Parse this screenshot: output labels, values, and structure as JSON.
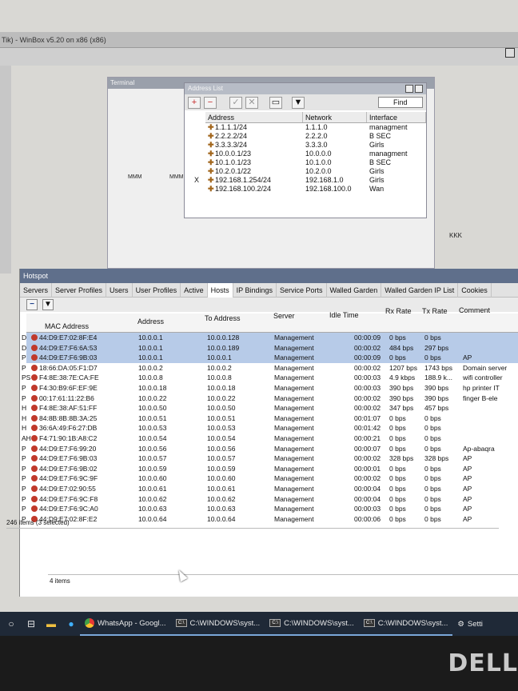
{
  "app": {
    "window_title": "Tik) - WinBox v5.20 on x86 (x86)"
  },
  "terminal": {
    "title": "Terminal",
    "labels": [
      "MMM",
      "MMM",
      "KKK"
    ]
  },
  "address_list": {
    "title": "Address List",
    "find_label": "Find",
    "columns": [
      "Address",
      "Network",
      "Interface"
    ],
    "rows": [
      {
        "flag": "",
        "address": "1.1.1.1/24",
        "network": "1.1.1.0",
        "interface": "managment"
      },
      {
        "flag": "",
        "address": "2.2.2.2/24",
        "network": "2.2.2.0",
        "interface": "B SEC"
      },
      {
        "flag": "",
        "address": "3.3.3.3/24",
        "network": "3.3.3.0",
        "interface": "Girls"
      },
      {
        "flag": "",
        "address": "10.0.0.1/23",
        "network": "10.0.0.0",
        "interface": "managment"
      },
      {
        "flag": "",
        "address": "10.1.0.1/23",
        "network": "10.1.0.0",
        "interface": "B SEC"
      },
      {
        "flag": "",
        "address": "10.2.0.1/22",
        "network": "10.2.0.0",
        "interface": "Girls"
      },
      {
        "flag": "X",
        "address": "192.168.1.254/24",
        "network": "192.168.1.0",
        "interface": "Girls"
      },
      {
        "flag": "",
        "address": "192.168.100.2/24",
        "network": "192.168.100.0",
        "interface": "Wan"
      }
    ]
  },
  "hotspot": {
    "title": "Hotspot",
    "tabs": [
      "Servers",
      "Server Profiles",
      "Users",
      "User Profiles",
      "Active",
      "Hosts",
      "IP Bindings",
      "Service Ports",
      "Walled Garden",
      "Walled Garden IP List",
      "Cookies"
    ],
    "active_tab": "Hosts",
    "columns": [
      "MAC Address",
      "Address",
      "To Address",
      "Server",
      "Idle Time",
      "Rx Rate",
      "Tx Rate",
      "Comment"
    ],
    "rows": [
      {
        "flag": "D",
        "mac": "44:D9:E7:02:8F:E4",
        "address": "10.0.0.1",
        "to": "10.0.0.128",
        "server": "Management",
        "idle": "00:00:09",
        "rx": "0 bps",
        "tx": "0 bps",
        "comment": "",
        "selected": true
      },
      {
        "flag": "D",
        "mac": "44:D9:E7:F6:6A:53",
        "address": "10.0.0.1",
        "to": "10.0.0.189",
        "server": "Management",
        "idle": "00:00:02",
        "rx": "484 bps",
        "tx": "297 bps",
        "comment": "",
        "selected": true
      },
      {
        "flag": "P",
        "mac": "44:D9:E7:F6:9B:03",
        "address": "10.0.0.1",
        "to": "10.0.0.1",
        "server": "Management",
        "idle": "00:00:09",
        "rx": "0 bps",
        "tx": "0 bps",
        "comment": "AP",
        "selected": true
      },
      {
        "flag": "P",
        "mac": "18:66:DA:05:F1:D7",
        "address": "10.0.0.2",
        "to": "10.0.0.2",
        "server": "Management",
        "idle": "00:00:02",
        "rx": "1207 bps",
        "tx": "1743 bps",
        "comment": "Domain server",
        "selected": false
      },
      {
        "flag": "PS",
        "mac": "F4:8E:38:7E:CA:FE",
        "address": "10.0.0.8",
        "to": "10.0.0.8",
        "server": "Management",
        "idle": "00:00:03",
        "rx": "4.9 kbps",
        "tx": "188.9 k...",
        "comment": "wifi controller",
        "selected": false
      },
      {
        "flag": "P",
        "mac": "F4:30:B9:6F:EF:9E",
        "address": "10.0.0.18",
        "to": "10.0.0.18",
        "server": "Management",
        "idle": "00:00:03",
        "rx": "390 bps",
        "tx": "390 bps",
        "comment": "hp printer IT",
        "selected": false
      },
      {
        "flag": "P",
        "mac": "00:17:61:11:22:B6",
        "address": "10.0.0.22",
        "to": "10.0.0.22",
        "server": "Management",
        "idle": "00:00:02",
        "rx": "390 bps",
        "tx": "390 bps",
        "comment": "finger B-ele",
        "selected": false
      },
      {
        "flag": "H",
        "mac": "F4:8E:38:AF:51:FF",
        "address": "10.0.0.50",
        "to": "10.0.0.50",
        "server": "Management",
        "idle": "00:00:02",
        "rx": "347 bps",
        "tx": "457 bps",
        "comment": "",
        "selected": false
      },
      {
        "flag": "H",
        "mac": "84:8B:8B:8B:3A:25",
        "address": "10.0.0.51",
        "to": "10.0.0.51",
        "server": "Management",
        "idle": "00:01:07",
        "rx": "0 bps",
        "tx": "0 bps",
        "comment": "",
        "selected": false
      },
      {
        "flag": "H",
        "mac": "36:6A:49:F6:27:DB",
        "address": "10.0.0.53",
        "to": "10.0.0.53",
        "server": "Management",
        "idle": "00:01:42",
        "rx": "0 bps",
        "tx": "0 bps",
        "comment": "",
        "selected": false
      },
      {
        "flag": "AH",
        "mac": "F4:71:90:1B:A8:C2",
        "address": "10.0.0.54",
        "to": "10.0.0.54",
        "server": "Management",
        "idle": "00:00:21",
        "rx": "0 bps",
        "tx": "0 bps",
        "comment": "",
        "selected": false
      },
      {
        "flag": "P",
        "mac": "44:D9:E7:F6:99:20",
        "address": "10.0.0.56",
        "to": "10.0.0.56",
        "server": "Management",
        "idle": "00:00:07",
        "rx": "0 bps",
        "tx": "0 bps",
        "comment": "Ap-abaqra",
        "selected": false
      },
      {
        "flag": "P",
        "mac": "44:D9:E7:F6:9B:03",
        "address": "10.0.0.57",
        "to": "10.0.0.57",
        "server": "Management",
        "idle": "00:00:02",
        "rx": "328 bps",
        "tx": "328 bps",
        "comment": "AP",
        "selected": false
      },
      {
        "flag": "P",
        "mac": "44:D9:E7:F6:9B:02",
        "address": "10.0.0.59",
        "to": "10.0.0.59",
        "server": "Management",
        "idle": "00:00:01",
        "rx": "0 bps",
        "tx": "0 bps",
        "comment": "AP",
        "selected": false
      },
      {
        "flag": "P",
        "mac": "44:D9:E7:F6:9C:9F",
        "address": "10.0.0.60",
        "to": "10.0.0.60",
        "server": "Management",
        "idle": "00:00:02",
        "rx": "0 bps",
        "tx": "0 bps",
        "comment": "AP",
        "selected": false
      },
      {
        "flag": "P",
        "mac": "44:D9:E7:02:90:55",
        "address": "10.0.0.61",
        "to": "10.0.0.61",
        "server": "Management",
        "idle": "00:00:04",
        "rx": "0 bps",
        "tx": "0 bps",
        "comment": "AP",
        "selected": false
      },
      {
        "flag": "P",
        "mac": "44:D9:E7:F6:9C:F8",
        "address": "10.0.0.62",
        "to": "10.0.0.62",
        "server": "Management",
        "idle": "00:00:04",
        "rx": "0 bps",
        "tx": "0 bps",
        "comment": "AP",
        "selected": false
      },
      {
        "flag": "P",
        "mac": "44:D9:E7:F6:9C:A0",
        "address": "10.0.0.63",
        "to": "10.0.0.63",
        "server": "Management",
        "idle": "00:00:03",
        "rx": "0 bps",
        "tx": "0 bps",
        "comment": "AP",
        "selected": false
      },
      {
        "flag": "P",
        "mac": "44:D9:E7:02:8F:E2",
        "address": "10.0.0.64",
        "to": "10.0.0.64",
        "server": "Management",
        "idle": "00:00:06",
        "rx": "0 bps",
        "tx": "0 bps",
        "comment": "AP",
        "selected": false
      }
    ],
    "status": "246 items (3 selected)",
    "status2": "4 items"
  },
  "taskbar": {
    "items": [
      "WhatsApp - Googl...",
      "C:\\WINDOWS\\syst...",
      "C:\\WINDOWS\\syst...",
      "C:\\WINDOWS\\syst...",
      "Setti"
    ]
  },
  "brand": "DELL"
}
